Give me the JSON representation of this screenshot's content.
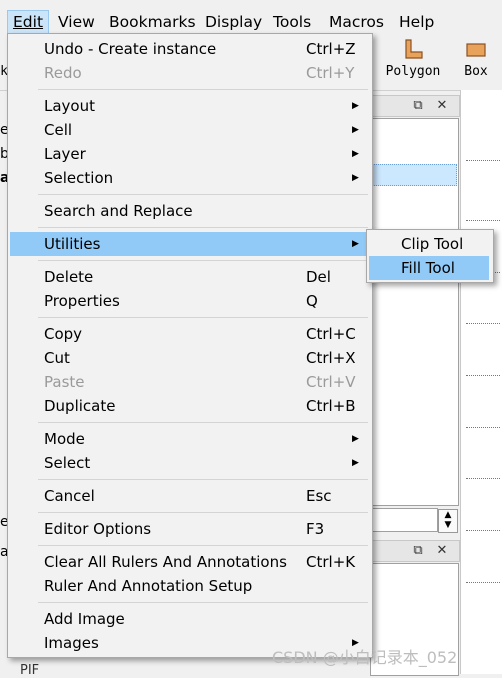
{
  "menubar": {
    "items": [
      {
        "label": "Edit",
        "active": true
      },
      {
        "label": "View"
      },
      {
        "label": "Bookmarks"
      },
      {
        "label": "Display"
      },
      {
        "label": "Tools"
      },
      {
        "label": "Macros"
      },
      {
        "label": "Help"
      }
    ]
  },
  "toolbar": {
    "polygon_label": "Polygon",
    "box_label": "Box",
    "partial_label": "k",
    "icon_color": "#c8843a"
  },
  "edit_menu": {
    "items": [
      {
        "label": "Undo - Create instance",
        "shortcut": "Ctrl+Z"
      },
      {
        "label": "Redo",
        "shortcut": "Ctrl+Y",
        "disabled": true
      },
      {
        "label": "Layout",
        "submenu": true
      },
      {
        "label": "Cell",
        "submenu": true
      },
      {
        "label": "Layer",
        "submenu": true
      },
      {
        "label": "Selection",
        "submenu": true
      },
      {
        "label": "Search and Replace"
      },
      {
        "label": "Utilities",
        "submenu": true,
        "highlighted": true
      },
      {
        "label": "Delete",
        "shortcut": "Del"
      },
      {
        "label": "Properties",
        "shortcut": "Q"
      },
      {
        "label": "Copy",
        "shortcut": "Ctrl+C"
      },
      {
        "label": "Cut",
        "shortcut": "Ctrl+X"
      },
      {
        "label": "Paste",
        "shortcut": "Ctrl+V",
        "disabled": true
      },
      {
        "label": "Duplicate",
        "shortcut": "Ctrl+B"
      },
      {
        "label": "Mode",
        "submenu": true
      },
      {
        "label": "Select",
        "submenu": true
      },
      {
        "label": "Cancel",
        "shortcut": "Esc"
      },
      {
        "label": "Editor Options",
        "shortcut": "F3"
      },
      {
        "label": "Clear All Rulers And Annotations",
        "shortcut": "Ctrl+K"
      },
      {
        "label": "Ruler And Annotation Setup"
      },
      {
        "label": "Add Image"
      },
      {
        "label": "Images",
        "submenu": true
      }
    ]
  },
  "utilities_submenu": {
    "items": [
      {
        "label": "Clip Tool"
      },
      {
        "label": "Fill Tool",
        "highlighted": true
      }
    ]
  },
  "left_strip": {
    "fragments": [
      "e",
      "b",
      "a",
      "e",
      "a"
    ]
  },
  "bottom": {
    "partial_text": "PIF"
  },
  "watermark": "CSDN @小白记录本_052",
  "colors": {
    "menu_highlight": "#91c9f7",
    "menubar_active": "#cce4f7",
    "disabled_text": "#9a9a9a"
  }
}
